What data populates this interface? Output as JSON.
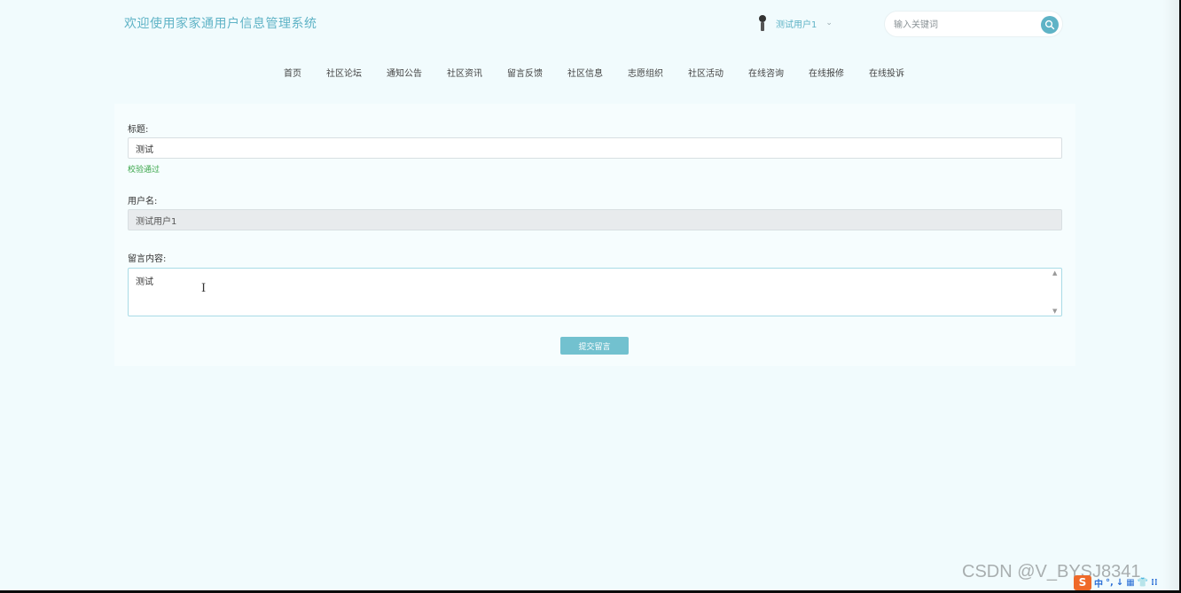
{
  "header": {
    "site_title": "欢迎使用家家通用户信息管理系统",
    "user_name": "测试用户1",
    "user_caret": "⌄",
    "search_placeholder": "输入关键词"
  },
  "nav": {
    "items": [
      "首页",
      "社区论坛",
      "通知公告",
      "社区资讯",
      "留言反馈",
      "社区信息",
      "志愿组织",
      "社区活动",
      "在线咨询",
      "在线报修",
      "在线投诉"
    ]
  },
  "form": {
    "title_label": "标题:",
    "title_value": "测试",
    "title_valid_msg": "校验通过",
    "username_label": "用户名:",
    "username_value": "测试用户1",
    "content_label": "留言内容:",
    "content_value": "测试",
    "submit_label": "提交留言"
  },
  "watermark": "CSDN @V_BYSJ8341",
  "tray": {
    "logo": "S",
    "items": [
      "中",
      "°,",
      "↓",
      "▦",
      "👕",
      "⁝⁝"
    ]
  },
  "colors": {
    "accent": "#5fb3c6",
    "button": "#72c1cf",
    "valid": "#3aa64a"
  }
}
